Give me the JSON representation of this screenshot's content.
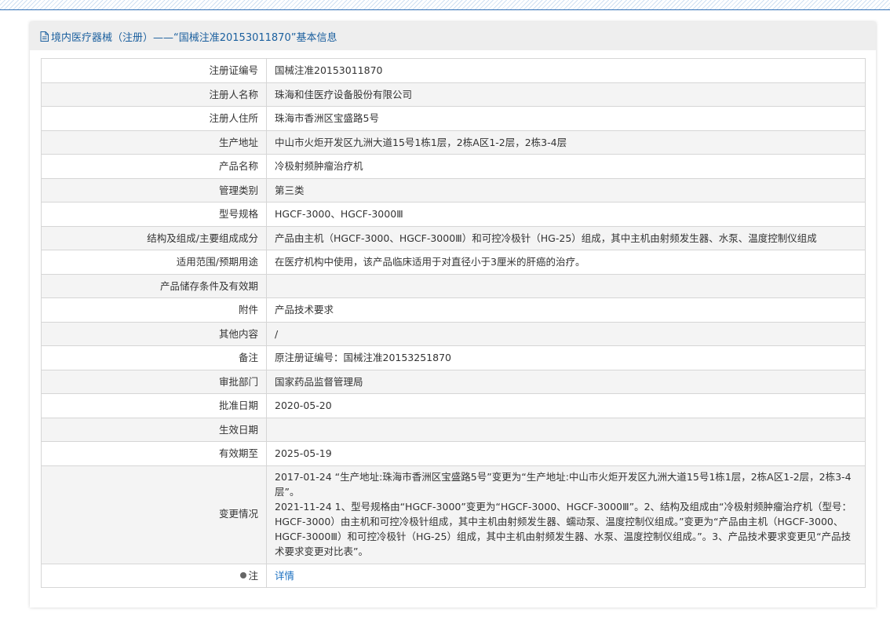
{
  "header": {
    "title": "境内医疗器械（注册）——“国械注准20153011870”基本信息",
    "icon": "document-icon"
  },
  "rows": [
    {
      "label": "注册证编号",
      "value": "国械注准20153011870"
    },
    {
      "label": "注册人名称",
      "value": "珠海和佳医疗设备股份有限公司"
    },
    {
      "label": "注册人住所",
      "value": "珠海市香洲区宝盛路5号"
    },
    {
      "label": "生产地址",
      "value": "中山市火炬开发区九洲大道15号1栋1层，2栋A区1-2层，2栋3-4层"
    },
    {
      "label": "产品名称",
      "value": "冷极射频肿瘤治疗机"
    },
    {
      "label": "管理类别",
      "value": "第三类"
    },
    {
      "label": "型号规格",
      "value": "HGCF-3000、HGCF-3000Ⅲ"
    },
    {
      "label": "结构及组成/主要组成成分",
      "value": "产品由主机（HGCF-3000、HGCF-3000Ⅲ）和可控冷极针（HG-25）组成，其中主机由射频发生器、水泵、温度控制仪组成"
    },
    {
      "label": "适用范围/预期用途",
      "value": "在医疗机构中使用，该产品临床适用于对直径小于3厘米的肝癌的治疗。"
    },
    {
      "label": "产品储存条件及有效期",
      "value": ""
    },
    {
      "label": "附件",
      "value": "产品技术要求"
    },
    {
      "label": "其他内容",
      "value": "/"
    },
    {
      "label": "备注",
      "value": "原注册证编号：国械注准20153251870"
    },
    {
      "label": "审批部门",
      "value": "国家药品监督管理局"
    },
    {
      "label": "批准日期",
      "value": "2020-05-20"
    },
    {
      "label": "生效日期",
      "value": ""
    },
    {
      "label": "有效期至",
      "value": "2025-05-19"
    }
  ],
  "changes": {
    "label": "变更情况",
    "entries": [
      "2017-01-24 “生产地址:珠海市香洲区宝盛路5号”变更为“生产地址:中山市火炬开发区九洲大道15号1栋1层，2栋A区1-2层，2栋3-4层”。",
      "2021-11-24 1、型号规格由“HGCF-3000”变更为“HGCF-3000、HGCF-3000Ⅲ”。2、结构及组成由“冷极射频肿瘤治疗机（型号：HGCF-3000）由主机和可控冷极针组成，其中主机由射频发生器、蠕动泵、温度控制仪组成。”变更为“产品由主机（HGCF-3000、HGCF-3000Ⅲ）和可控冷极针（HG-25）组成，其中主机由射频发生器、水泵、温度控制仪组成。”。3、产品技术要求变更见“产品技术要求变更对比表”。"
    ]
  },
  "note": {
    "label": "注",
    "icon": "bullet-icon",
    "link_text": "详情"
  }
}
